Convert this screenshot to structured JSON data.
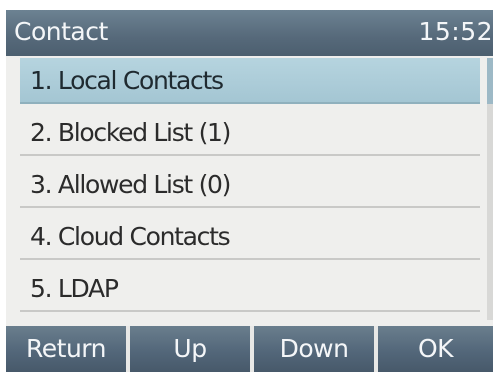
{
  "header": {
    "title": "Contact",
    "time": "15:52"
  },
  "menu": {
    "selected_index": 0,
    "items": [
      {
        "label": "1. Local Contacts"
      },
      {
        "label": "2. Blocked List (1)"
      },
      {
        "label": "3. Allowed List (0)"
      },
      {
        "label": "4. Cloud Contacts"
      },
      {
        "label": "5. LDAP"
      }
    ]
  },
  "softkeys": {
    "return_label": "Return",
    "up_label": "Up",
    "down_label": "Down",
    "ok_label": "OK"
  },
  "colors": {
    "titlebar": "#56697a",
    "selected_row": "#a9c9d6",
    "background": "#efefed",
    "text": "#2b2b2b"
  }
}
